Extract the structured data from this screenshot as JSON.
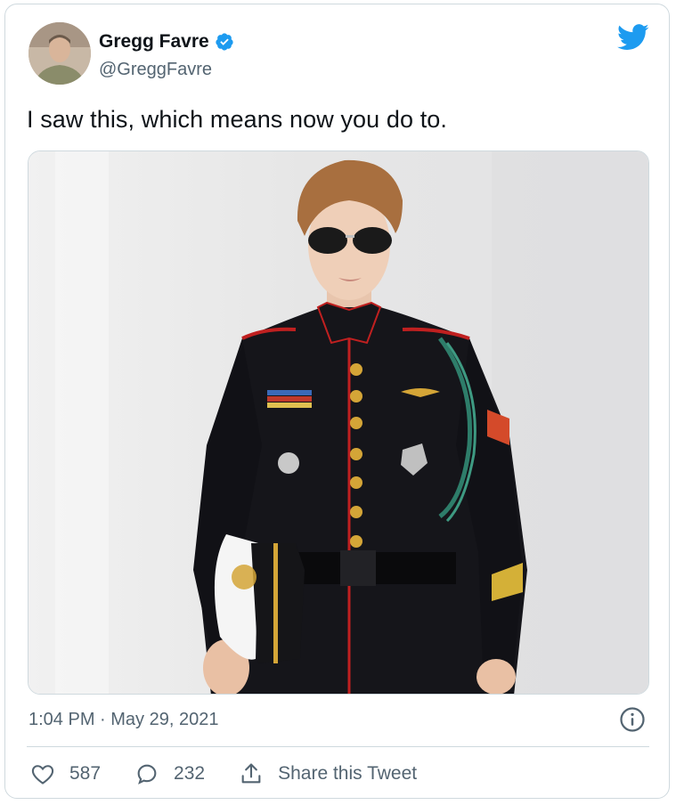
{
  "tweet": {
    "author_name": "Gregg Favre",
    "author_handle": "@GreggFavre",
    "text": "I saw this, which means now you do to.",
    "timestamp": "1:04 PM · May 29, 2021",
    "likes": "587",
    "replies": "232",
    "share_label": "Share this Tweet"
  },
  "icons": {
    "verified": "verified-badge-icon",
    "brand": "twitter-bird-icon",
    "info": "info-icon",
    "like": "heart-icon",
    "reply": "speech-bubble-icon",
    "share": "share-icon"
  },
  "colors": {
    "brand_blue": "#1d9bf0",
    "text": "#0f1419",
    "muted": "#536471",
    "border": "#cfd9de"
  }
}
